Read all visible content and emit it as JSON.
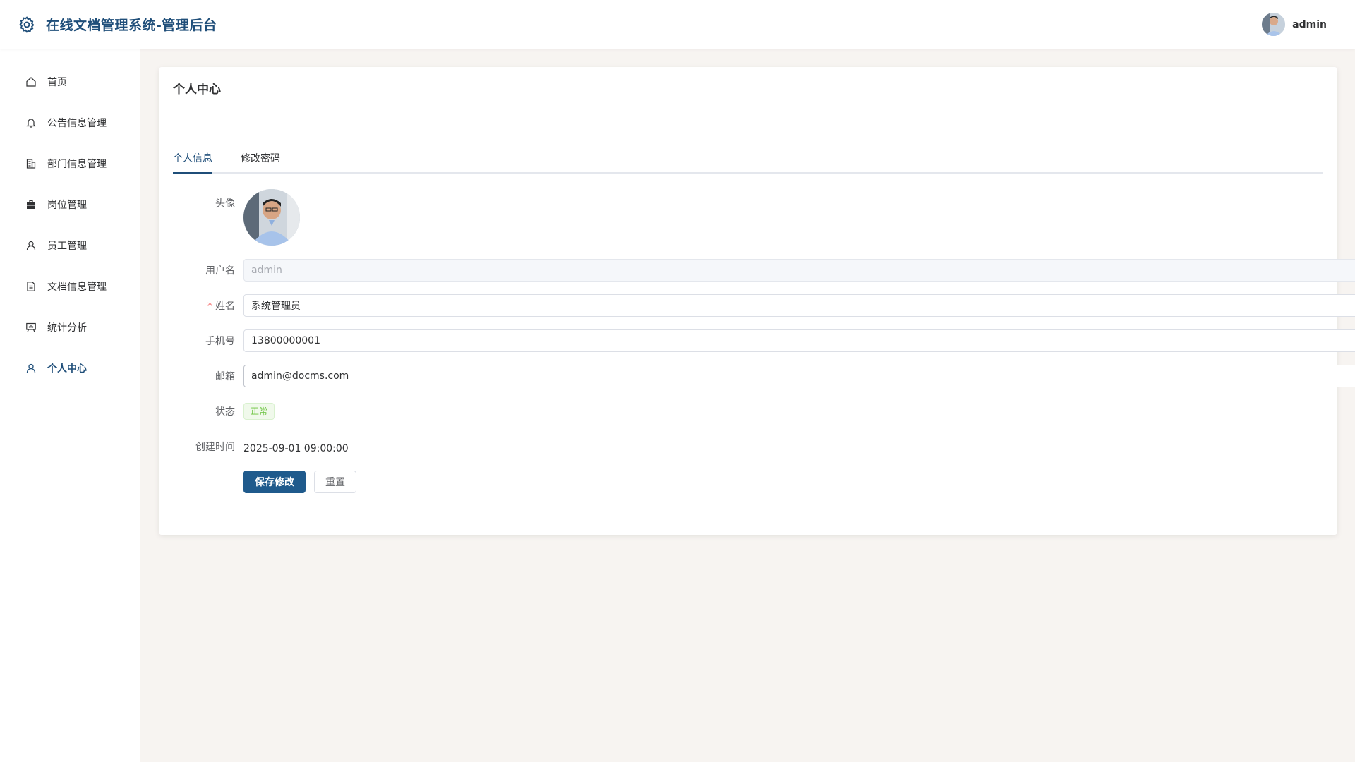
{
  "app": {
    "title": "在线文档管理系统-管理后台",
    "brand_icon": "gear-icon"
  },
  "user": {
    "name": "admin"
  },
  "sidebar": {
    "items": [
      {
        "label": "首页",
        "icon": "home-icon"
      },
      {
        "label": "公告信息管理",
        "icon": "bell-icon"
      },
      {
        "label": "部门信息管理",
        "icon": "building-icon"
      },
      {
        "label": "岗位管理",
        "icon": "briefcase-icon"
      },
      {
        "label": "员工管理",
        "icon": "user-icon"
      },
      {
        "label": "文档信息管理",
        "icon": "document-icon"
      },
      {
        "label": "统计分析",
        "icon": "chart-board-icon"
      },
      {
        "label": "个人中心",
        "icon": "user-icon",
        "active": true
      }
    ]
  },
  "page": {
    "title": "个人中心"
  },
  "tabs": [
    {
      "label": "个人信息",
      "active": true
    },
    {
      "label": "修改密码",
      "active": false
    }
  ],
  "form": {
    "avatar_label": "头像",
    "username_label": "用户名",
    "username_value": "admin",
    "name_label": "姓名",
    "name_value": "系统管理员",
    "phone_label": "手机号",
    "phone_value": "13800000001",
    "email_label": "邮箱",
    "email_value": "admin@docms.com",
    "status_label": "状态",
    "status_value": "正常",
    "created_label": "创建时间",
    "created_value": "2025-09-01 09:00:00",
    "save_label": "保存修改",
    "reset_label": "重置"
  },
  "colors": {
    "brand": "#1f4e79",
    "primary_button": "#1f5a8c",
    "status_success": "#67c23a",
    "background": "#f7f4f1"
  }
}
